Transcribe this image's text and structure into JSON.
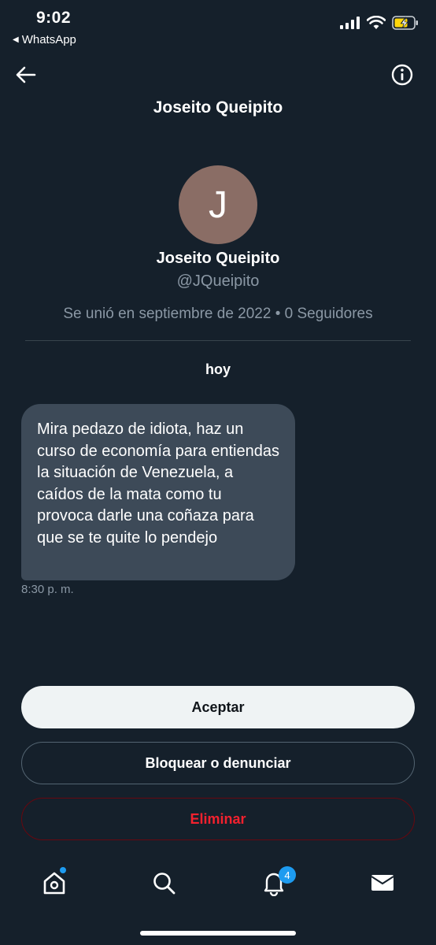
{
  "status_bar": {
    "time": "9:02",
    "back_app": "WhatsApp",
    "icons": [
      "signal-icon",
      "wifi-icon",
      "battery-charging-icon"
    ]
  },
  "nav": {
    "title": "Joseito Queipito",
    "back_icon": "arrow-left-icon",
    "info_icon": "info-icon"
  },
  "profile": {
    "avatar_initial": "J",
    "avatar_color": "#8a6d65",
    "name": "Joseito Queipito",
    "handle": "@JQueipito",
    "meta": "Se unió en septiembre de 2022 • 0 Seguidores"
  },
  "conversation": {
    "day_label": "hoy",
    "messages": [
      {
        "text": "Mira pedazo de idiota, haz un curso de economía para entiendas la situación de Venezuela, a caídos de la mata como tu provoca darle una coñaza para que se te quite lo pendejo",
        "time": "8:30 p. m."
      }
    ]
  },
  "actions": {
    "accept": "Aceptar",
    "block_report": "Bloquear o denunciar",
    "delete": "Eliminar"
  },
  "tabbar": {
    "items": [
      "home-icon",
      "search-icon",
      "bell-icon",
      "mail-icon"
    ],
    "notifications_badge": "4"
  },
  "colors": {
    "background": "#15202b",
    "bubble": "#3d4a58",
    "accent": "#1d9bf0",
    "danger": "#f4212e"
  }
}
